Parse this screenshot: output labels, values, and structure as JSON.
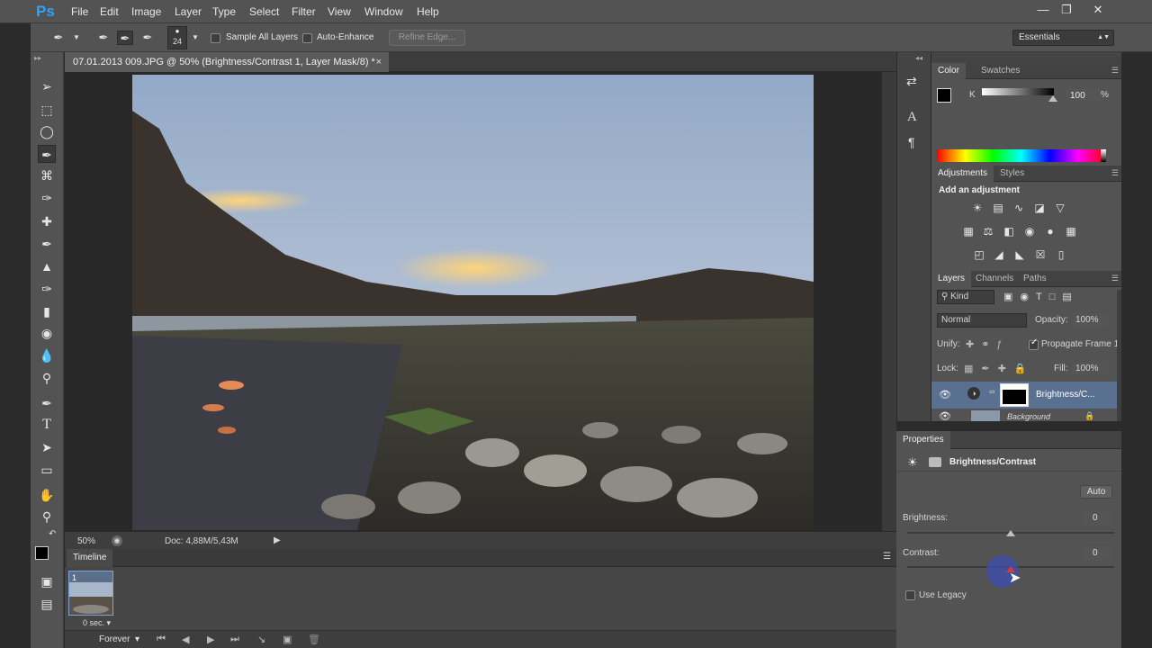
{
  "app": {
    "logo": "Ps",
    "menu": [
      "File",
      "Edit",
      "Image",
      "Layer",
      "Type",
      "Select",
      "Filter",
      "View",
      "Window",
      "Help"
    ],
    "window_controls": [
      "minimize-icon",
      "restore-icon",
      "close-icon"
    ]
  },
  "options_bar": {
    "brush_size": "24",
    "sample_all_layers": "Sample All Layers",
    "auto_enhance": "Auto-Enhance",
    "refine_edge": "Refine Edge...",
    "workspace": "Essentials"
  },
  "document": {
    "tab_title": "07.01.2013 009.JPG @ 50% (Brightness/Contrast 1, Layer Mask/8) *",
    "tab_close": "×",
    "zoom": "50%",
    "doc_info": "Doc: 4,88M/5,43M"
  },
  "timeline": {
    "title": "Timeline",
    "frame_number": "1",
    "frame_delay": "0 sec.",
    "loop": "Forever"
  },
  "color_panel": {
    "tabs": [
      "Color",
      "Swatches"
    ],
    "channel_label": "K",
    "value": "100",
    "unit": "%"
  },
  "adjustments_panel": {
    "tabs": [
      "Adjustments",
      "Styles"
    ],
    "heading": "Add an adjustment"
  },
  "layers_panel": {
    "tabs": [
      "Layers",
      "Channels",
      "Paths"
    ],
    "filter": "Kind",
    "blend_mode": "Normal",
    "opacity_label": "Opacity:",
    "opacity": "100%",
    "unify_label": "Unify:",
    "propagate": "Propagate Frame 1",
    "lock_label": "Lock:",
    "fill_label": "Fill:",
    "fill": "100%",
    "layers": [
      {
        "name": "Brightness/C..."
      },
      {
        "name": "Background"
      }
    ]
  },
  "properties_panel": {
    "title": "Properties",
    "adjustment_name": "Brightness/Contrast",
    "auto_label": "Auto",
    "brightness_label": "Brightness:",
    "brightness_value": "0",
    "contrast_label": "Contrast:",
    "contrast_value": "0",
    "use_legacy": "Use Legacy"
  },
  "colors": {
    "accent_blue": "#2fa3ff",
    "panel_bg": "#535353",
    "cursor_highlight": "#d83a3a"
  }
}
